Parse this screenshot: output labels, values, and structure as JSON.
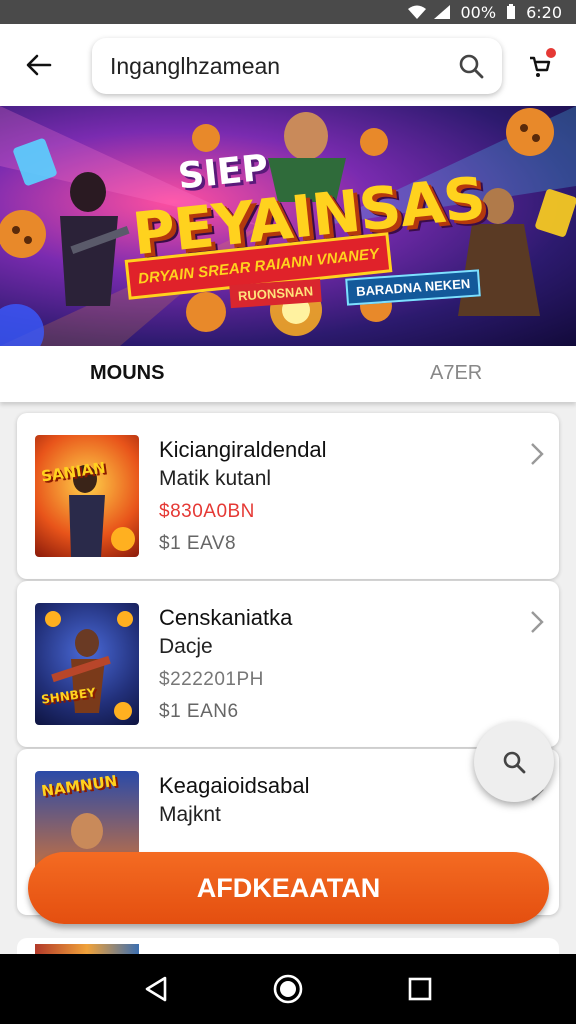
{
  "status_bar": {
    "battery": "00%",
    "time": "6:20"
  },
  "header": {
    "search_text": "Inganglhzamean"
  },
  "banner": {
    "title_line1": "SIEP",
    "title_line2": "PEYAINSAS",
    "ribbon": "DRYAIN SREAR RAIANN VNANEY",
    "tag_red": "RUONSNAN",
    "tag_blue": "BARADNA NEKEN"
  },
  "tabs": {
    "first": "MOUNS",
    "second": "A7ER"
  },
  "items": [
    {
      "title": "Kiciangiraldendal",
      "subtitle": "Matik kutanl",
      "price": "$830A0BN",
      "meta": "$1 EAV8",
      "thumb_label": "SANIAN"
    },
    {
      "title": "Censkaniatka",
      "subtitle": "Dacje",
      "price": "$222201PH",
      "meta": "$1 EAN6",
      "thumb_label": "SHNBEY"
    },
    {
      "title": "Keagaioidsabal",
      "subtitle": "Majknt",
      "price": "",
      "meta": "",
      "thumb_label": "NAMNUN"
    }
  ],
  "cta": {
    "label": "AFDKEAATAN"
  },
  "colors": {
    "accent": "#f05a1a",
    "price": "#e53935",
    "cart_dot": "#e53935"
  },
  "icons": [
    "back-arrow-icon",
    "search-icon",
    "cart-icon",
    "chevron-right-icon",
    "nav-back-icon",
    "nav-home-icon",
    "nav-recents-icon"
  ]
}
